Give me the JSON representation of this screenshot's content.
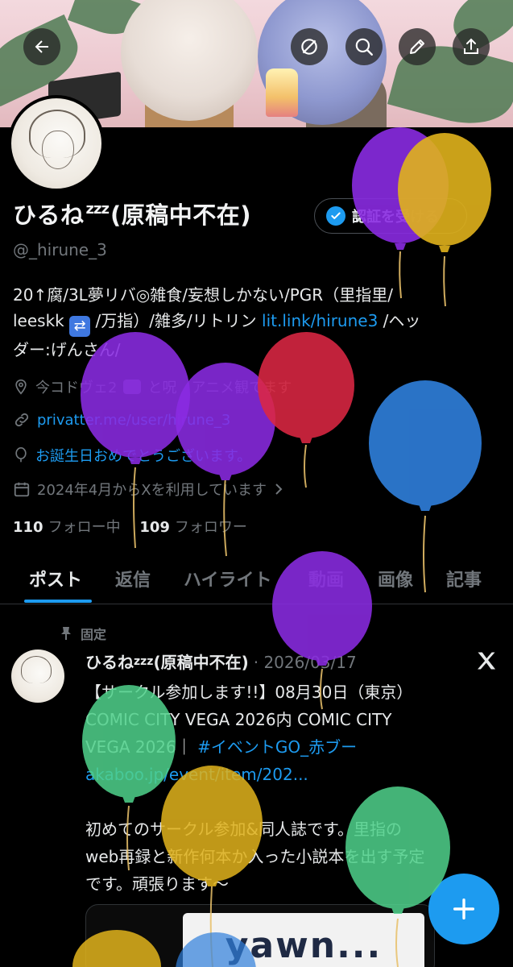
{
  "header": {
    "back_icon": "arrow-left-icon",
    "actions": [
      "hide-icon",
      "search-icon",
      "pencil-icon",
      "share-icon"
    ]
  },
  "profile": {
    "display_name": "ひるね",
    "zzz": "zzz",
    "display_name_suffix": "(原稿中不在)",
    "verify_label": "認証を受ける",
    "handle": "@_hirune_3",
    "bio_line1": "20↑腐/3L夢リバ◎雑食/妄想しかない/PGR（里指里/",
    "bio_line2_a": "leeskk",
    "bio_line2_b": "/万指）/雑多/リトリン",
    "bio_link": "lit.link/hirune3",
    "bio_line2_c": " /ヘッ",
    "bio_line3": "ダー:げんさん/",
    "location": "今コドヴェ2",
    "location_tail": "と呪　アニメ観てます",
    "website": "privatter.me/user/hirune_3",
    "birthday": "お誕生日おめでとうございます。",
    "joined": "2024年4月からXを利用しています",
    "following_count": "110",
    "following_label": "フォロー中",
    "followers_count": "109",
    "followers_label": "フォロワー"
  },
  "tabs": [
    "ポスト",
    "返信",
    "ハイライト",
    "動画",
    "画像",
    "記事"
  ],
  "post": {
    "pinned_label": "固定",
    "author": "ひるね",
    "author_zzz": "zzz",
    "author_suffix": "(原稿中不在)",
    "date": "· 2026/03/17",
    "line1": "【サークル参加します!!】08月30日（東京）",
    "line2": "COMIC CITY VEGA 2026内 COMIC CITY",
    "line3_a": "VEGA 2026｜ ",
    "hashtag": "#イベントGO_赤ブー",
    "line4_link": "akaboo.jp/event/item/202...",
    "para2_line1": "初めてのサークル参加&同人誌です。里指の",
    "para2_line2": "web再録と新作何本か入った小説本を出す予定",
    "para2_line3": "です。頑張ります〜",
    "media_text": "yawn..."
  },
  "colors": {
    "accent": "#1d9bf0",
    "muted": "#71767b",
    "text": "#e7e9ea",
    "balloon_purple": "#8a2be2",
    "balloon_yellow": "#e0b21c",
    "balloon_red": "#dc2743",
    "balloon_blue": "#2f7fdc",
    "balloon_green": "#4fd18b"
  }
}
